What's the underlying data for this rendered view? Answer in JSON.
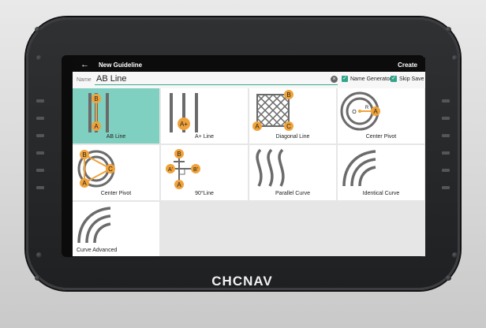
{
  "device": {
    "brand": "CHCNAV"
  },
  "titlebar": {
    "back": "←",
    "title": "New Guideline",
    "create": "Create"
  },
  "name": {
    "label": "Name",
    "value": "AB Line",
    "clear": "×",
    "name_generator": "Name Generator",
    "skip_save": "Skip Save",
    "check": "✓"
  },
  "guidelines": [
    {
      "label": "AB Line",
      "selected": true
    },
    {
      "label": "A+ Line"
    },
    {
      "label": "Diagonal Line"
    },
    {
      "label": "Center Pivot"
    },
    {
      "label": "Center Pivot"
    },
    {
      "label": "90°Line"
    },
    {
      "label": "Parallel Curve"
    },
    {
      "label": "Identical Curve"
    },
    {
      "label": "Curve Advanced"
    }
  ],
  "points": {
    "a": "A",
    "b": "B",
    "c": "C",
    "a_plus": "A+",
    "o": "O",
    "r": "R",
    "a_prime": "A'",
    "b_prime": "B'"
  },
  "colors": {
    "accent": "#33a58c",
    "selected": "#7fd0c0",
    "marker": "#f0a23a",
    "icon": "#6b6b6b"
  }
}
